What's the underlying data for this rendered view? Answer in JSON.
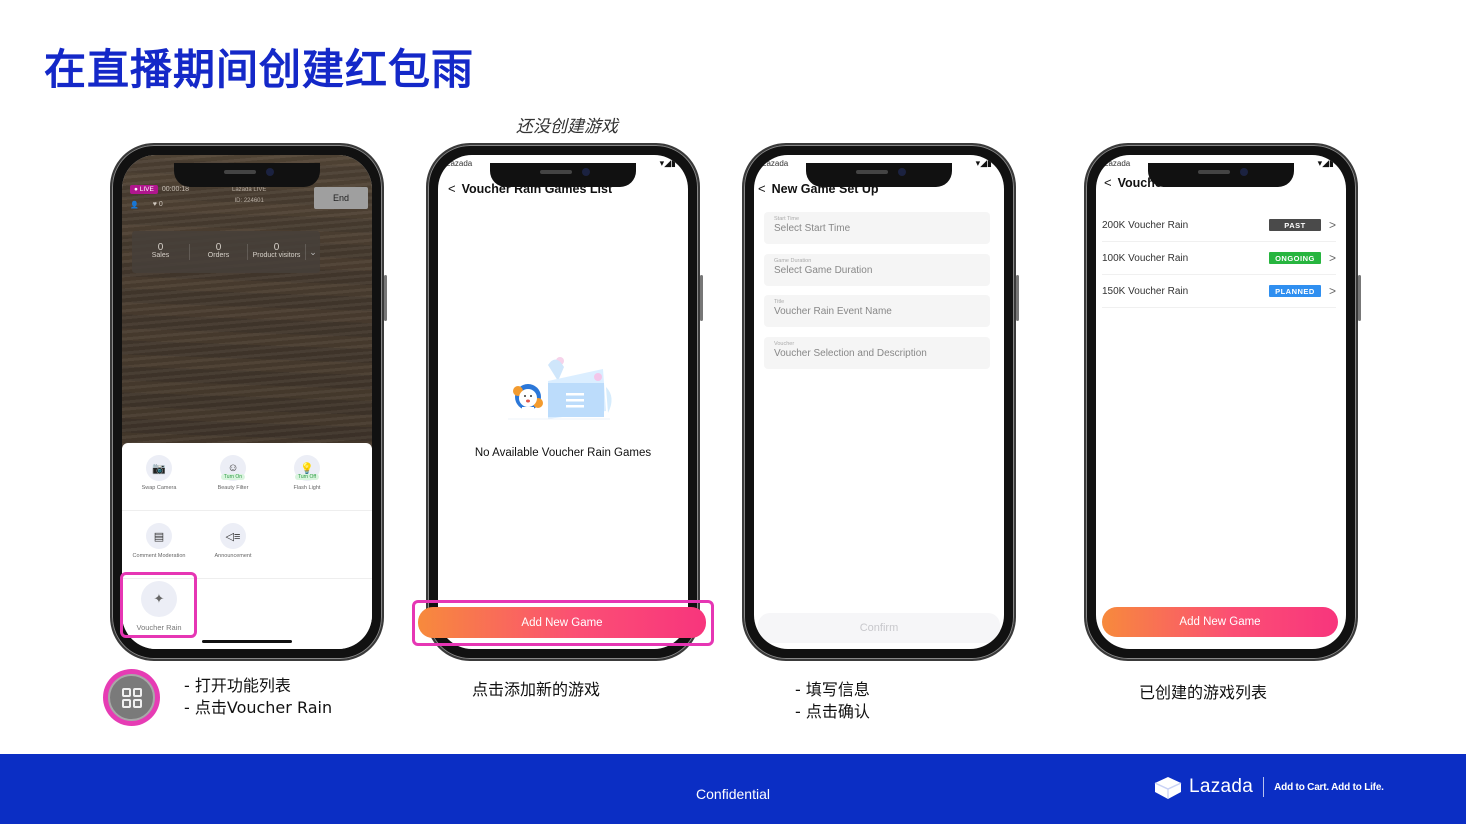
{
  "slide": {
    "title": "在直播期间创建红包雨",
    "subtitle": "还没创建游戏"
  },
  "phone1": {
    "live_badge": "● LIVE",
    "timer": "00:00:18",
    "room_brand": "Lazada LIVE",
    "room_id": "ID: 224601",
    "viewer_icon": "👤",
    "likes": "♥ 0",
    "end_button": "End",
    "stats": [
      {
        "value": "0",
        "label": "Sales"
      },
      {
        "value": "0",
        "label": "Orders"
      },
      {
        "value": "0",
        "label": "Product visitors"
      }
    ],
    "stats_toggle": "⌄",
    "functions_row1": [
      {
        "icon": "📷",
        "label": "Swap Camera",
        "tag": ""
      },
      {
        "icon": "☺",
        "label": "Beauty Filter",
        "tag": "Turn On"
      },
      {
        "icon": "💡",
        "label": "Flash Light",
        "tag": "Turn Off"
      }
    ],
    "functions_row2": [
      {
        "icon": "▤",
        "label": "Comment Moderation",
        "tag": ""
      },
      {
        "icon": "◁≡",
        "label": "Announcement",
        "tag": ""
      }
    ],
    "voucher_rain": {
      "icon": "✦",
      "label": "Voucher Rain"
    }
  },
  "phone2": {
    "status_app": "Lazada",
    "status_icons": "▾◢▮",
    "back": "<",
    "title": "Voucher Rain Games List",
    "empty_text": "No Available Voucher Rain Games",
    "add_button": "Add New Game"
  },
  "phone3": {
    "status_app": "Lazada",
    "status_icons": "▾◢▮",
    "back": "<",
    "title": "New Game Set Up",
    "fields": [
      {
        "label": "Start Time",
        "placeholder": "Select Start Time"
      },
      {
        "label": "Game Duration",
        "placeholder": "Select Game Duration"
      },
      {
        "label": "Title",
        "placeholder": "Voucher Rain Event Name"
      },
      {
        "label": "Voucher",
        "placeholder": "Voucher Selection and Description"
      }
    ],
    "confirm_button": "Confirm"
  },
  "phone4": {
    "status_app": "Lazada",
    "status_icons": "▾◢▮",
    "back": "<",
    "title": "Voucher Rain Games List",
    "games": [
      {
        "name": "200K Voucher Rain",
        "status": "PAST",
        "color": "#4a4a4a"
      },
      {
        "name": "100K Voucher Rain",
        "status": "ONGOING",
        "color": "#27b53f"
      },
      {
        "name": "150K Voucher Rain",
        "status": "PLANNED",
        "color": "#2f8ff0"
      }
    ],
    "chevron": ">",
    "add_button": "Add New Game"
  },
  "captions": {
    "step1_line1": "- 打开功能列表",
    "step1_line2": "- 点击Voucher Rain",
    "step2": "点击添加新的游戏",
    "step3_line1": "- 填写信息",
    "step3_line2": "- 点击确认",
    "step4": "已创建的游戏列表"
  },
  "footer": {
    "confidential": "Confidential",
    "brand_name": "Lazada",
    "tagline": "Add to Cart. Add to Life."
  },
  "colors": {
    "title_blue": "#1428c8",
    "footer_blue": "#0b2ec4",
    "highlight_pink": "#e636b4",
    "gradient_start": "#f78a3c",
    "gradient_end": "#f8357d"
  }
}
